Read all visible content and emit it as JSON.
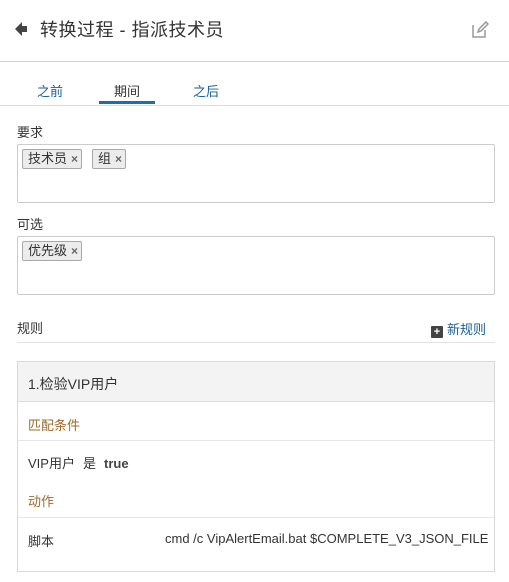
{
  "header": {
    "title": "转换过程 - 指派技术员",
    "back_icon": "arrow-left-icon",
    "edit_icon": "edit-icon"
  },
  "tabs": [
    {
      "label": "之前",
      "active": false
    },
    {
      "label": "期间",
      "active": true
    },
    {
      "label": "之后",
      "active": false
    }
  ],
  "required": {
    "label": "要求",
    "tags": [
      "技术员",
      "组"
    ]
  },
  "optional": {
    "label": "可选",
    "tags": [
      "优先级"
    ]
  },
  "rules": {
    "label": "规则",
    "new_rule_label": "新规则",
    "items": [
      {
        "title": "1.检验VIP用户",
        "conditions_label": "匹配条件",
        "condition": {
          "field": "VIP用户",
          "operator": "是",
          "value": "true"
        },
        "actions_label": "动作",
        "action": {
          "key": "脚本",
          "value": "cmd /c VipAlertEmail.bat $COMPLETE_V3_JSON_FILE"
        }
      }
    ]
  },
  "colors": {
    "accent": "#1a6fae",
    "link": "#1a5e96",
    "section_heading": "#9b6b2b"
  }
}
